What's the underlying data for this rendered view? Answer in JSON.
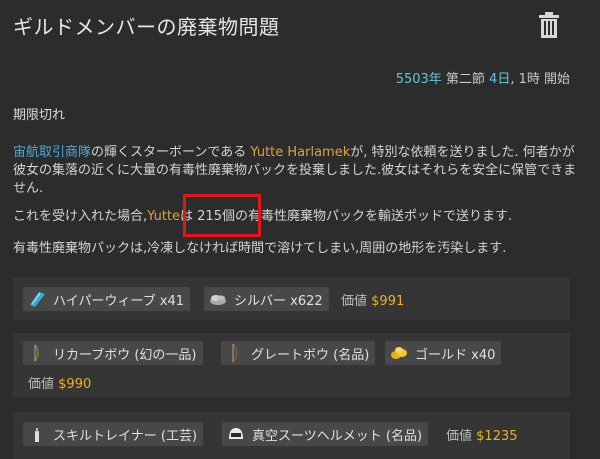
{
  "title": "ギルドメンバーの廃棄物問題",
  "date": {
    "year": "5503年",
    "part1": " 第二節 ",
    "day": "4日",
    "part2": ", 1時 開始"
  },
  "section_title": "期限切れ",
  "para1": {
    "faction": "宙航取引商隊",
    "t1": "の輝くスターボーンである ",
    "person": "Yutte Harlamek",
    "t2": "が, 特別な依頼を送りました. 何者かが彼女の集落の近くに大量の有毒性廃棄物パックを投棄しました.彼女はそれらを安全に保管できません."
  },
  "para2": {
    "t1": "これを受け入れた場合,",
    "person": "Yutte",
    "t2": "は 215個の有毒性廃棄物パックを輸送ポッドで送ります."
  },
  "para3": "有毒性廃棄物パックは,冷凍しなければ時間で溶けてしまい,周囲の地形を汚染します.",
  "value_label": "価値",
  "options": [
    {
      "items": [
        {
          "icon": "hyperweave-icon",
          "label": "ハイパーウィーブ x41"
        },
        {
          "icon": "silver-icon",
          "label": "シルバー x622"
        }
      ],
      "value": "$991"
    },
    {
      "items": [
        {
          "icon": "recurve-bow-icon",
          "label": "リカーブボウ (幻の一品)"
        },
        {
          "icon": "great-bow-icon",
          "label": "グレートボウ (名品)"
        },
        {
          "icon": "gold-icon",
          "label": "ゴールド x40"
        }
      ],
      "value": "$990"
    },
    {
      "items": [
        {
          "icon": "skill-trainer-icon",
          "label": "スキルトレイナー (工芸)"
        },
        {
          "icon": "vacsuit-helmet-icon",
          "label": "真空スーツヘルメット (名品)"
        }
      ],
      "value": "$1235"
    }
  ],
  "colors": {
    "background": "#2c2c2c",
    "faction": "#4fa9da",
    "person": "#d9a441",
    "date_highlight": "#64c3d9",
    "value": "#e6b422",
    "highlight_box": "#e0161c"
  }
}
